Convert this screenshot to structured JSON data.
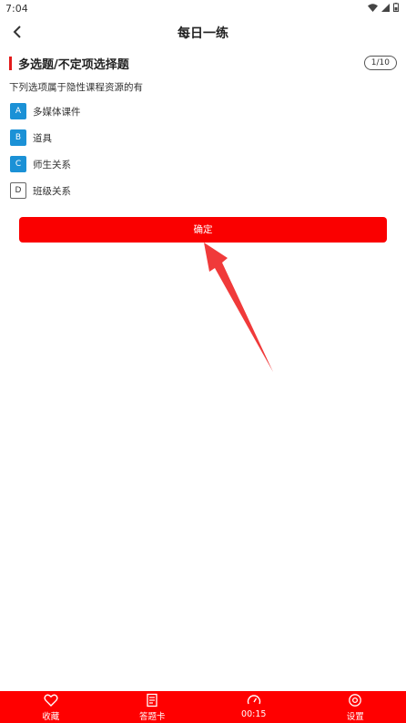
{
  "status_bar": {
    "time": "7:04"
  },
  "app_bar": {
    "title": "每日一练"
  },
  "question": {
    "type": "多选题/不定项选择题",
    "counter": "1/10",
    "text": "下列选项属于隐性课程资源的有",
    "options": [
      {
        "letter": "A",
        "text": "多媒体课件",
        "selected": true
      },
      {
        "letter": "B",
        "text": "道具",
        "selected": true
      },
      {
        "letter": "C",
        "text": "师生关系",
        "selected": true
      },
      {
        "letter": "D",
        "text": "班级关系",
        "selected": false
      }
    ]
  },
  "confirm_label": "确定",
  "bottom_tabs": [
    {
      "label": "收藏",
      "icon": "heart-icon"
    },
    {
      "label": "答题卡",
      "icon": "answer-sheet-icon"
    },
    {
      "label": "00:15",
      "icon": "timer-gauge-icon"
    },
    {
      "label": "设置",
      "icon": "settings-icon"
    }
  ],
  "colors": {
    "accent_red": "#ff0000",
    "selected_blue": "#1b91d6",
    "annotation_arrow": "#f03a3a"
  }
}
